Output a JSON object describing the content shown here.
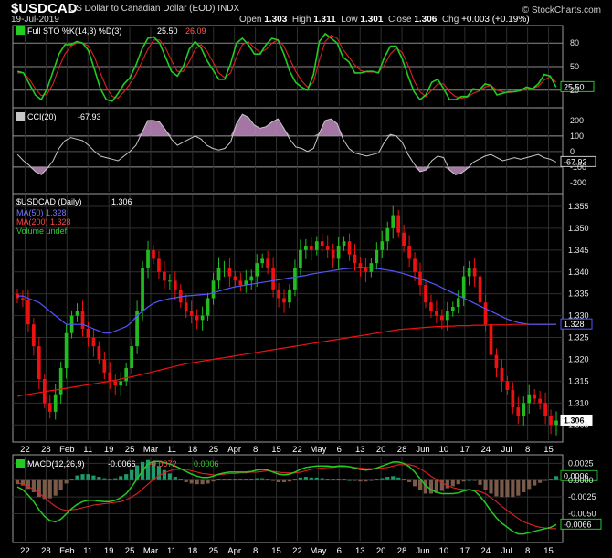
{
  "header": {
    "symbol": "$USDCAD",
    "name": "US Dollar to Canadian Dollar (EOD)",
    "exchange": "INDX",
    "date": "19-Jul-2019",
    "open_label": "Open",
    "open": "1.303",
    "high_label": "High",
    "high": "1.311",
    "low_label": "Low",
    "low": "1.301",
    "close_label": "Close",
    "close": "1.306",
    "chg_label": "Chg",
    "chg": "+0.003 (+0.19%)",
    "copyright": "© StockCharts.com"
  },
  "chart_data": [
    {
      "id": "stochastic",
      "type": "line",
      "title": "Full STO %K(14,3) %D(3)",
      "values_text": [
        "25.50",
        "26.09"
      ],
      "series": [
        {
          "name": "%K(14,3)",
          "color": "#22cc22",
          "values": [
            44,
            42,
            28,
            14,
            8,
            22,
            44,
            66,
            78,
            78,
            82,
            80,
            70,
            46,
            22,
            8,
            6,
            16,
            28,
            36,
            52,
            72,
            86,
            88,
            80,
            62,
            44,
            38,
            50,
            72,
            82,
            74,
            58,
            46,
            34,
            34,
            54,
            80,
            86,
            78,
            66,
            66,
            78,
            86,
            84,
            66,
            44,
            30,
            24,
            20,
            40,
            82,
            92,
            86,
            80,
            62,
            56,
            42,
            42,
            44,
            44,
            42,
            62,
            76,
            76,
            60,
            38,
            18,
            8,
            14,
            30,
            34,
            22,
            8,
            8,
            12,
            12,
            22,
            20,
            28,
            26,
            14,
            16,
            18,
            18,
            20,
            24,
            22,
            28,
            40,
            38,
            24
          ]
        },
        {
          "name": "%D(3)",
          "color": "#dd2222",
          "values": [
            42,
            42,
            34,
            22,
            13,
            15,
            28,
            49,
            66,
            76,
            80,
            80,
            76,
            62,
            42,
            24,
            12,
            10,
            18,
            28,
            40,
            56,
            72,
            84,
            84,
            74,
            58,
            44,
            44,
            56,
            72,
            78,
            70,
            56,
            42,
            36,
            42,
            62,
            78,
            82,
            74,
            68,
            72,
            80,
            84,
            76,
            60,
            44,
            32,
            24,
            30,
            58,
            82,
            90,
            86,
            72,
            62,
            52,
            45,
            43,
            43,
            43,
            52,
            66,
            74,
            68,
            52,
            32,
            18,
            12,
            20,
            28,
            28,
            18,
            12,
            10,
            11,
            16,
            19,
            24,
            26,
            20,
            18,
            17,
            18,
            19,
            22,
            22,
            25,
            33,
            37,
            30
          ]
        }
      ],
      "ylim": [
        0,
        100
      ],
      "ticks": [
        "80",
        "50",
        "20"
      ],
      "last_value_label": "25.50"
    },
    {
      "id": "cci",
      "type": "line",
      "title": "CCI(20)",
      "value_text": "-67.93",
      "series": [
        {
          "name": "CCI(20)",
          "color": "#c8c8c8",
          "values": [
            -20,
            -60,
            -90,
            -130,
            -150,
            -110,
            -60,
            20,
            70,
            90,
            80,
            70,
            40,
            0,
            -30,
            -40,
            -50,
            -60,
            -30,
            0,
            40,
            120,
            200,
            200,
            190,
            140,
            80,
            40,
            60,
            80,
            100,
            80,
            40,
            20,
            10,
            20,
            60,
            180,
            240,
            220,
            170,
            150,
            160,
            190,
            210,
            150,
            80,
            30,
            20,
            0,
            20,
            120,
            200,
            210,
            180,
            80,
            20,
            -10,
            -20,
            -30,
            -20,
            -10,
            60,
            110,
            100,
            60,
            -20,
            -80,
            -130,
            -120,
            -60,
            -30,
            -40,
            -120,
            -150,
            -140,
            -110,
            -70,
            -50,
            -30,
            -20,
            -40,
            -60,
            -50,
            -40,
            -50,
            -40,
            -30,
            -20,
            -40,
            -50,
            -67.93
          ]
        }
      ],
      "ylim": [
        -260,
        270
      ],
      "ticks": [
        "200",
        "100",
        "0",
        "-100",
        "-200"
      ],
      "last_value_label": "-67.93"
    },
    {
      "id": "price",
      "type": "candlestick",
      "title": "$USDCAD (Daily)",
      "value_text": "1.306",
      "legend": [
        {
          "label": "MA(50)",
          "value": "1.328",
          "color": "#5555ff"
        },
        {
          "label": "MA(200)",
          "value": "1.328",
          "color": "#ee1111"
        },
        {
          "label": "Volume",
          "value": "undef",
          "color": "#22aa22"
        }
      ],
      "close": [
        1.334,
        1.3335,
        1.328,
        1.323,
        1.3155,
        1.31,
        1.308,
        1.312,
        1.318,
        1.326,
        1.33,
        1.331,
        1.327,
        1.325,
        1.323,
        1.32,
        1.317,
        1.315,
        1.314,
        1.315,
        1.318,
        1.323,
        1.331,
        1.341,
        1.345,
        1.343,
        1.34,
        1.338,
        1.338,
        1.336,
        1.333,
        1.331,
        1.33,
        1.329,
        1.33,
        1.334,
        1.338,
        1.341,
        1.341,
        1.339,
        1.338,
        1.337,
        1.338,
        1.339,
        1.342,
        1.343,
        1.341,
        1.336,
        1.334,
        1.333,
        1.336,
        1.341,
        1.345,
        1.346,
        1.345,
        1.347,
        1.346,
        1.345,
        1.343,
        1.346,
        1.347,
        1.344,
        1.342,
        1.341,
        1.34,
        1.342,
        1.345,
        1.347,
        1.35,
        1.353,
        1.349,
        1.346,
        1.343,
        1.34,
        1.337,
        1.333,
        1.331,
        1.33,
        1.329,
        1.331,
        1.332,
        1.334,
        1.339,
        1.341,
        1.339,
        1.333,
        1.328,
        1.321,
        1.318,
        1.315,
        1.313,
        1.309,
        1.307,
        1.31,
        1.312,
        1.311,
        1.31,
        1.307,
        1.305,
        1.306
      ],
      "ma50": [
        1.3345,
        1.3345,
        1.334,
        1.3335,
        1.333,
        1.332,
        1.331,
        1.33,
        1.329,
        1.328,
        1.328,
        1.328,
        1.328,
        1.3275,
        1.327,
        1.3265,
        1.326,
        1.326,
        1.3265,
        1.327,
        1.3275,
        1.3285,
        1.33,
        1.331,
        1.332,
        1.3328,
        1.3333,
        1.3336,
        1.3339,
        1.3341,
        1.3343,
        1.3345,
        1.3346,
        1.3347,
        1.3348,
        1.3349,
        1.3352,
        1.3356,
        1.336,
        1.3363,
        1.3366,
        1.3368,
        1.337,
        1.3372,
        1.3374,
        1.3376,
        1.3378,
        1.338,
        1.3382,
        1.3384,
        1.3386,
        1.3388,
        1.339,
        1.3392,
        1.3395,
        1.3397,
        1.3399,
        1.3401,
        1.3403,
        1.3405,
        1.3407,
        1.3408,
        1.3409,
        1.341,
        1.341,
        1.3409,
        1.3408,
        1.3406,
        1.3404,
        1.3402,
        1.3399,
        1.3396,
        1.3392,
        1.3388,
        1.3384,
        1.338,
        1.3375,
        1.337,
        1.3364,
        1.3358,
        1.3352,
        1.3346,
        1.334,
        1.3334,
        1.3328,
        1.3322,
        1.3316,
        1.331,
        1.3304,
        1.3298,
        1.3292,
        1.3288,
        1.3284,
        1.3282,
        1.328,
        1.328,
        1.328,
        1.328,
        1.328,
        1.328
      ],
      "ma200": [
        1.3115,
        1.3118,
        1.312,
        1.3122,
        1.3124,
        1.3126,
        1.3128,
        1.313,
        1.3132,
        1.3134,
        1.3136,
        1.3138,
        1.314,
        1.3142,
        1.3144,
        1.3146,
        1.3148,
        1.315,
        1.3152,
        1.3155,
        1.3158,
        1.316,
        1.3163,
        1.3166,
        1.3169,
        1.3172,
        1.3175,
        1.3178,
        1.3181,
        1.3184,
        1.3187,
        1.319,
        1.3192,
        1.3194,
        1.3196,
        1.3198,
        1.32,
        1.3202,
        1.3204,
        1.3206,
        1.3208,
        1.321,
        1.3212,
        1.3214,
        1.3216,
        1.3218,
        1.322,
        1.3222,
        1.3224,
        1.3226,
        1.3228,
        1.323,
        1.3232,
        1.3234,
        1.3236,
        1.3238,
        1.324,
        1.3242,
        1.3244,
        1.3246,
        1.3248,
        1.325,
        1.3252,
        1.3254,
        1.3256,
        1.3258,
        1.326,
        1.3262,
        1.3264,
        1.3266,
        1.3268,
        1.3269,
        1.327,
        1.3271,
        1.3272,
        1.3273,
        1.3274,
        1.3275,
        1.3275,
        1.3276,
        1.3276,
        1.3277,
        1.3277,
        1.3277,
        1.3278,
        1.3278,
        1.3278,
        1.3279,
        1.3279,
        1.3279,
        1.3279,
        1.328,
        1.328,
        1.328,
        1.328,
        1.328,
        1.328,
        1.328,
        1.328,
        1.328
      ],
      "ylim": [
        1.3015,
        1.3575
      ],
      "ticks": [
        "1.355",
        "1.350",
        "1.345",
        "1.340",
        "1.335",
        "1.330",
        "1.325",
        "1.320",
        "1.315",
        "1.310",
        "1.305"
      ],
      "ma_label": "1.328",
      "last_value_label": "1.306"
    },
    {
      "id": "macd",
      "type": "line",
      "title": "MACD(12,26,9)",
      "values_text": [
        "-0.0066",
        "-0.0072",
        "0.0006"
      ],
      "series": [
        {
          "name": "MACD",
          "color": "#22cc22",
          "values": [
            -0.001,
            -0.0014,
            -0.0022,
            -0.0032,
            -0.0044,
            -0.0054,
            -0.006,
            -0.0062,
            -0.0058,
            -0.005,
            -0.0042,
            -0.0036,
            -0.0032,
            -0.003,
            -0.003,
            -0.0031,
            -0.0032,
            -0.0032,
            -0.003,
            -0.0026,
            -0.002,
            -0.001,
            0.0002,
            0.0014,
            0.0024,
            0.0028,
            0.0028,
            0.0026,
            0.0024,
            0.0021,
            0.0017,
            0.0013,
            0.0009,
            0.0006,
            0.0004,
            0.0004,
            0.0006,
            0.0009,
            0.0011,
            0.0012,
            0.0012,
            0.0012,
            0.0012,
            0.0013,
            0.0015,
            0.0016,
            0.0015,
            0.0012,
            0.0009,
            0.0008,
            0.0009,
            0.0012,
            0.0016,
            0.0019,
            0.002,
            0.0021,
            0.0021,
            0.0021,
            0.002,
            0.0021,
            0.0021,
            0.002,
            0.0018,
            0.0016,
            0.0015,
            0.0016,
            0.0018,
            0.0021,
            0.0024,
            0.0027,
            0.0027,
            0.0025,
            0.002,
            0.0012,
            0.0002,
            -0.0008,
            -0.0014,
            -0.0018,
            -0.002,
            -0.002,
            -0.002,
            -0.0019,
            -0.0016,
            -0.0014,
            -0.0016,
            -0.0024,
            -0.0034,
            -0.0046,
            -0.0056,
            -0.0064,
            -0.007,
            -0.0076,
            -0.008,
            -0.008,
            -0.0078,
            -0.0076,
            -0.0074,
            -0.0072,
            -0.007,
            -0.0066
          ]
        },
        {
          "name": "Signal",
          "color": "#dd2222",
          "values": [
            -0.0004,
            -0.0006,
            -0.0009,
            -0.0014,
            -0.0019,
            -0.0026,
            -0.0033,
            -0.0039,
            -0.0043,
            -0.0045,
            -0.0044,
            -0.0043,
            -0.0041,
            -0.0039,
            -0.0037,
            -0.0036,
            -0.0035,
            -0.0034,
            -0.0033,
            -0.0032,
            -0.0029,
            -0.0025,
            -0.002,
            -0.0013,
            -0.0006,
            0.0001,
            0.0007,
            0.0011,
            0.0014,
            0.0016,
            0.0016,
            0.0016,
            0.0014,
            0.0012,
            0.001,
            0.0009,
            0.0008,
            0.0008,
            0.0009,
            0.001,
            0.001,
            0.0011,
            0.0011,
            0.0012,
            0.0012,
            0.0013,
            0.0014,
            0.0013,
            0.0012,
            0.0011,
            0.0011,
            0.0011,
            0.0012,
            0.0014,
            0.0016,
            0.0017,
            0.0018,
            0.0019,
            0.0019,
            0.002,
            0.002,
            0.002,
            0.0019,
            0.0018,
            0.0017,
            0.0017,
            0.0017,
            0.0018,
            0.0019,
            0.0021,
            0.0023,
            0.0023,
            0.0023,
            0.0021,
            0.0017,
            0.0012,
            0.0006,
            0.0001,
            -0.0004,
            -0.0008,
            -0.0011,
            -0.0013,
            -0.0014,
            -0.0014,
            -0.0015,
            -0.0017,
            -0.002,
            -0.0026,
            -0.0032,
            -0.0039,
            -0.0045,
            -0.0051,
            -0.0057,
            -0.0062,
            -0.0065,
            -0.0068,
            -0.007,
            -0.0071,
            -0.0072,
            -0.0072
          ]
        }
      ],
      "ylim": [
        -0.009,
        0.0035
      ],
      "ticks": [
        "0.0025",
        "0.0000",
        "-0.0025",
        "-0.0050"
      ],
      "labels_right": [
        "0.0006",
        "-0.0066"
      ]
    }
  ],
  "x_axis_dates": [
    "22",
    "28",
    "Feb",
    "11",
    "19",
    "25",
    "Mar",
    "11",
    "18",
    "25",
    "Apr",
    "8",
    "15",
    "22",
    "May",
    "6",
    "13",
    "20",
    "28",
    "Jun",
    "10",
    "17",
    "24",
    "Jul",
    "8",
    "15"
  ],
  "colors": {
    "background": "#000000",
    "grid": "#2f2f2f",
    "frame": "#9a9a9a",
    "up": "#22bb22",
    "down": "#ee1111",
    "ma50": "#5555ff",
    "ma200": "#ee1111",
    "cci_fill": "#c08bc0"
  }
}
